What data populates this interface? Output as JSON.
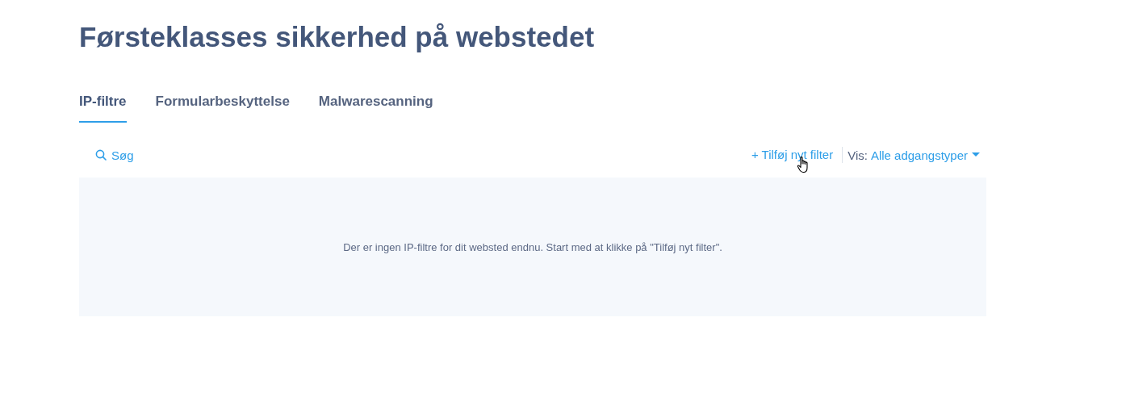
{
  "title": "Førsteklasses sikkerhed på webstedet",
  "tabs": [
    {
      "label": "IP-filtre",
      "selected": true
    },
    {
      "label": "Formularbeskyttelse",
      "selected": false
    },
    {
      "label": "Malwarescanning",
      "selected": false
    }
  ],
  "search": {
    "label": "Søg"
  },
  "add_button": {
    "label": "+ Tilføj nyt filter"
  },
  "view_filter": {
    "label": "Vis:",
    "value": "Alle adgangstyper"
  },
  "empty_message": "Der er ingen IP-filtre for dit websted endnu. Start med at klikke på \"Tilføj nyt filter\"."
}
